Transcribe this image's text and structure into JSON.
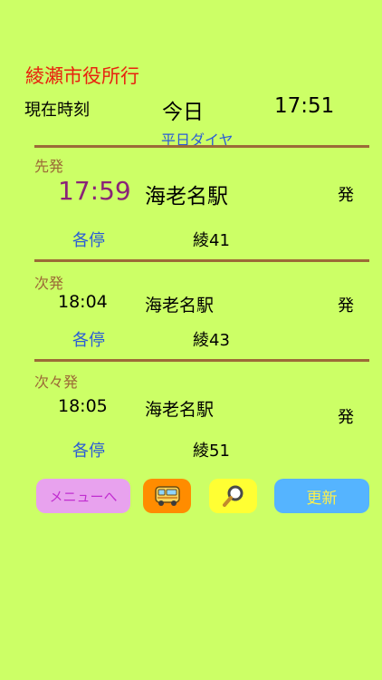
{
  "header": {
    "title": "綾瀬市役所行",
    "now_label": "現在時刻",
    "day": "今日",
    "time": "17:51",
    "schedule": "平日ダイヤ"
  },
  "departures": [
    {
      "slot": "先発",
      "time": "17:59",
      "station": "海老名駅",
      "suffix": "発",
      "kind": "各停",
      "route": "綾41"
    },
    {
      "slot": "次発",
      "time": "18:04",
      "station": "海老名駅",
      "suffix": "発",
      "kind": "各停",
      "route": "綾43"
    },
    {
      "slot": "次々発",
      "time": "18:05",
      "station": "海老名駅",
      "suffix": "発",
      "kind": "各停",
      "route": "綾51"
    }
  ],
  "buttons": {
    "menu_label": "メニューへ",
    "bus_icon": "bus-icon",
    "search_icon": "search-icon",
    "refresh_label": "更新"
  },
  "colors": {
    "background": "#ccff66",
    "title": "#e8220e",
    "accent_blue": "#2a5bd7",
    "divider": "#9b6a37",
    "first_time": "#8a2378",
    "menu_button": "#e8a2ee",
    "bus_button": "#ff8c00",
    "search_button": "#ffff33",
    "refresh_button": "#55b4ff"
  }
}
